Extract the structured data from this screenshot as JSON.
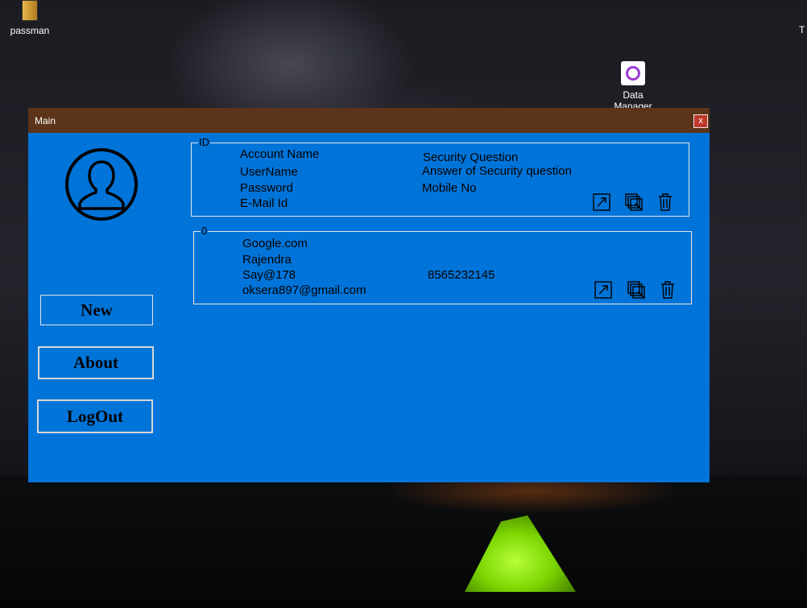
{
  "desktop": {
    "icons": [
      {
        "label": "passman",
        "icon": "folder-icon"
      },
      {
        "label": "Data\nManager",
        "icon": "data-manager-icon"
      }
    ],
    "edge_glyph": "T"
  },
  "window": {
    "title": "Main",
    "close_label": "x",
    "avatar_icon": "user-avatar-icon",
    "buttons": {
      "new": "New",
      "about": "About",
      "logout": "LogOut"
    },
    "header_record": {
      "legend": "ID",
      "account_name": "Account Name",
      "username": "UserName",
      "password": "Password",
      "email": "E-Mail Id",
      "security_question": "Security Question",
      "security_answer": "Answer of Security question",
      "mobile": "Mobile No",
      "actions": [
        "open-external-icon",
        "copy-icon",
        "trash-icon"
      ]
    },
    "records": [
      {
        "legend": "0",
        "account_name": "Google.com",
        "username": "Rajendra",
        "password": "Say@178",
        "email": "oksera897@gmail.com",
        "security_question": "",
        "security_answer": "",
        "mobile": "8565232145",
        "actions": [
          "open-external-icon",
          "copy-icon",
          "trash-icon"
        ]
      }
    ]
  },
  "colors": {
    "titlebar": "#5c3419",
    "window_bg": "#0074d8",
    "close_button": "#c0392b"
  }
}
